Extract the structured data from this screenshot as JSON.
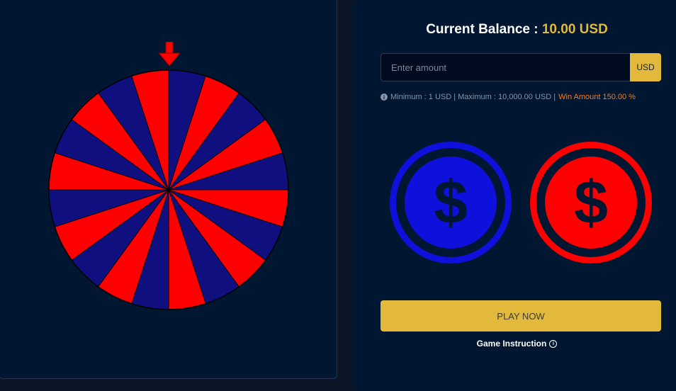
{
  "colors": {
    "page_bg": "#0a1526",
    "panel_bg": "#001631",
    "accent_gold": "#e2b93b",
    "wheel_red": "#ff0000",
    "wheel_blue": "#0f0f80",
    "coin_blue": "#1010dd",
    "coin_red": "#ff0000",
    "win_orange": "#ff7a1a"
  },
  "wheel": {
    "pointer_icon": "down-arrow-icon",
    "segment_count": 20,
    "segments_pattern": [
      "blue",
      "red"
    ]
  },
  "balance": {
    "label": "Current Balance :",
    "value": "10.00 USD"
  },
  "amount": {
    "placeholder": "Enter amount",
    "value": "",
    "currency": "USD"
  },
  "limits": {
    "icon": "info-icon",
    "text": "Minimum : 1 USD | Maximum : 10,000.00 USD |",
    "win_text": "Win Amount 150.00 %"
  },
  "coins": [
    {
      "name": "blue-coin",
      "symbol": "$",
      "color": "blue"
    },
    {
      "name": "red-coin",
      "symbol": "$",
      "color": "red"
    }
  ],
  "play_button": {
    "label": "PLAY NOW"
  },
  "instruction": {
    "label": "Game Instruction",
    "icon": "info-icon"
  }
}
